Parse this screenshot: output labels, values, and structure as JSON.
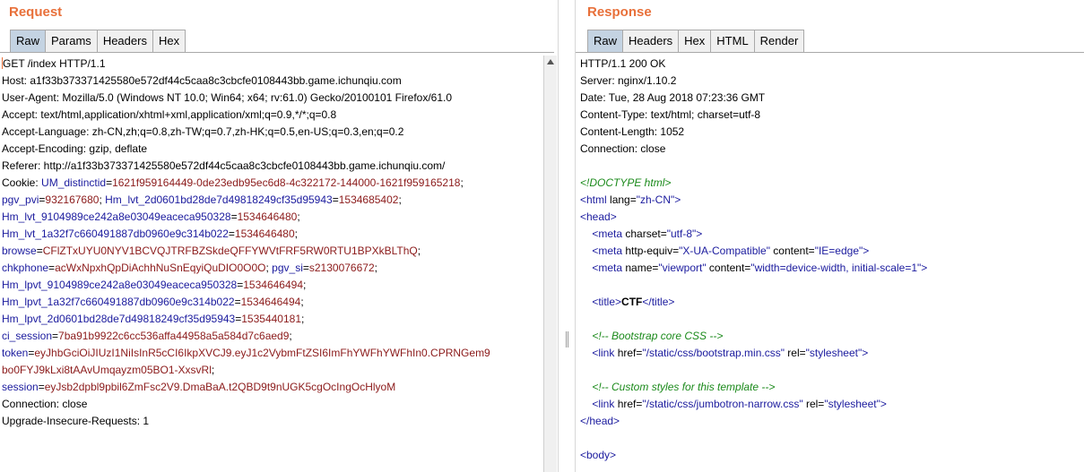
{
  "request": {
    "title": "Request",
    "tabs": [
      "Raw",
      "Params",
      "Headers",
      "Hex"
    ],
    "active_tab": "Raw",
    "lines": [
      {
        "text": "GET /index HTTP/1.1"
      },
      {
        "text": "Host: a1f33b373371425580e572df44c5caa8c3cbcfe0108443bb.game.ichunqiu.com"
      },
      {
        "text": "User-Agent: Mozilla/5.0 (Windows NT 10.0; Win64; x64; rv:61.0) Gecko/20100101 Firefox/61.0"
      },
      {
        "text": "Accept: text/html,application/xhtml+xml,application/xml;q=0.9,*/*;q=0.8"
      },
      {
        "text": "Accept-Language: zh-CN,zh;q=0.8,zh-TW;q=0.7,zh-HK;q=0.5,en-US;q=0.3,en;q=0.2"
      },
      {
        "text": "Accept-Encoding: gzip, deflate"
      },
      {
        "text": "Referer: http://a1f33b373371425580e572df44c5caa8c3cbcfe0108443bb.game.ichunqiu.com/"
      }
    ],
    "cookie_label": "Cookie: ",
    "cookies": [
      {
        "line": 0,
        "key": "UM_distinctid",
        "value": "1621f959164449-0de23edb95ec6d8-4c322172-144000-1621f959165218",
        "sep": ";"
      },
      {
        "line": 1,
        "key": "pgv_pvi",
        "value": "932167680",
        "sep": "; "
      },
      {
        "line": 1,
        "key": "Hm_lvt_2d0601bd28de7d49818249cf35d95943",
        "value": "1534685402",
        "sep": ";"
      },
      {
        "line": 2,
        "key": "Hm_lvt_9104989ce242a8e03049eaceca950328",
        "value": "1534646480",
        "sep": ";"
      },
      {
        "line": 3,
        "key": "Hm_lvt_1a32f7c660491887db0960e9c314b022",
        "value": "1534646480",
        "sep": ";"
      },
      {
        "line": 4,
        "key": "browse",
        "value": "CFlZTxUYU0NYV1BCVQJTRFBZSkdeQFFYWVtFRF5RW0RTU1BPXkBLThQ",
        "sep": ";"
      },
      {
        "line": 5,
        "key": "chkphone",
        "value": "acWxNpxhQpDiAchhNuSnEqyiQuDIO0O0O",
        "sep": "; "
      },
      {
        "line": 5,
        "key": "pgv_si",
        "value": "s2130076672",
        "sep": ";"
      },
      {
        "line": 6,
        "key": "Hm_lpvt_9104989ce242a8e03049eaceca950328",
        "value": "1534646494",
        "sep": ";"
      },
      {
        "line": 7,
        "key": "Hm_lpvt_1a32f7c660491887db0960e9c314b022",
        "value": "1534646494",
        "sep": ";"
      },
      {
        "line": 8,
        "key": "Hm_lpvt_2d0601bd28de7d49818249cf35d95943",
        "value": "1535440181",
        "sep": ";"
      },
      {
        "line": 9,
        "key": "ci_session",
        "value": "7ba91b9922c6cc536affa44958a5a584d7c6aed9",
        "sep": ";"
      },
      {
        "line": 10,
        "key": "token",
        "value": "eyJhbGciOiJIUzI1NiIsInR5cCI6IkpXVCJ9.eyJ1c2VybmFtZSI6ImFhYWFhYWFhIn0.CPRNGem9",
        "sep": ""
      },
      {
        "line": 11,
        "key": "",
        "value": "bo0FYJ9kLxi8tAAvUmqayzm05BO1-XxsvRl",
        "sep": ";"
      },
      {
        "line": 12,
        "key": "session",
        "value": "eyJsb2dpbl9pbil6ZmFsc2V9.DmaBaA.t2QBD9t9nUGK5cgOcIngOcHlyoM",
        "sep": ""
      }
    ],
    "trailing_lines": [
      {
        "text": "Connection: close"
      },
      {
        "text": "Upgrade-Insecure-Requests: 1"
      }
    ]
  },
  "response": {
    "title": "Response",
    "tabs": [
      "Raw",
      "Headers",
      "Hex",
      "HTML",
      "Render"
    ],
    "active_tab": "Raw",
    "headers": [
      "HTTP/1.1 200 OK",
      "Server: nginx/1.10.2",
      "Date: Tue, 28 Aug 2018 07:23:36 GMT",
      "Content-Type: text/html; charset=utf-8",
      "Content-Length: 1052",
      "Connection: close"
    ],
    "body": [
      {
        "kind": "blank"
      },
      {
        "kind": "comment",
        "indent": 0,
        "text": "<!DOCTYPE html>"
      },
      {
        "kind": "tag",
        "indent": 0,
        "open": "<html",
        "attrs": [
          {
            "name": "lang",
            "value": "\"zh-CN\""
          }
        ],
        "close": ">"
      },
      {
        "kind": "tag",
        "indent": 0,
        "open": "<head>",
        "attrs": [],
        "close": ""
      },
      {
        "kind": "tag",
        "indent": 1,
        "open": "<meta",
        "attrs": [
          {
            "name": "charset",
            "value": "\"utf-8\""
          }
        ],
        "close": ">"
      },
      {
        "kind": "tag",
        "indent": 1,
        "open": "<meta",
        "attrs": [
          {
            "name": "http-equiv",
            "value": "\"X-UA-Compatible\""
          },
          {
            "name": "content",
            "value": "\"IE=edge\""
          }
        ],
        "close": ">"
      },
      {
        "kind": "tag",
        "indent": 1,
        "open": "<meta",
        "attrs": [
          {
            "name": "name",
            "value": "\"viewport\""
          },
          {
            "name": "content",
            "value": "\"width=device-width, initial-scale=1\""
          }
        ],
        "close": ">"
      },
      {
        "kind": "blank"
      },
      {
        "kind": "title",
        "indent": 1,
        "open": "<title>",
        "text": "CTF",
        "close": "</title>"
      },
      {
        "kind": "blank"
      },
      {
        "kind": "comment",
        "indent": 1,
        "text": "<!-- Bootstrap core CSS -->"
      },
      {
        "kind": "tag",
        "indent": 1,
        "open": "<link",
        "attrs": [
          {
            "name": "href",
            "value": "\"/static/css/bootstrap.min.css\""
          },
          {
            "name": "rel",
            "value": "\"stylesheet\""
          }
        ],
        "close": ">"
      },
      {
        "kind": "blank"
      },
      {
        "kind": "comment",
        "indent": 1,
        "text": "<!-- Custom styles for this template -->"
      },
      {
        "kind": "tag",
        "indent": 1,
        "open": "<link",
        "attrs": [
          {
            "name": "href",
            "value": "\"/static/css/jumbotron-narrow.css\""
          },
          {
            "name": "rel",
            "value": "\"stylesheet\""
          }
        ],
        "close": ">"
      },
      {
        "kind": "tag",
        "indent": 0,
        "open": "</head>",
        "attrs": [],
        "close": ""
      },
      {
        "kind": "blank"
      },
      {
        "kind": "tag",
        "indent": 0,
        "open": "<body>",
        "attrs": [],
        "close": ""
      }
    ]
  }
}
